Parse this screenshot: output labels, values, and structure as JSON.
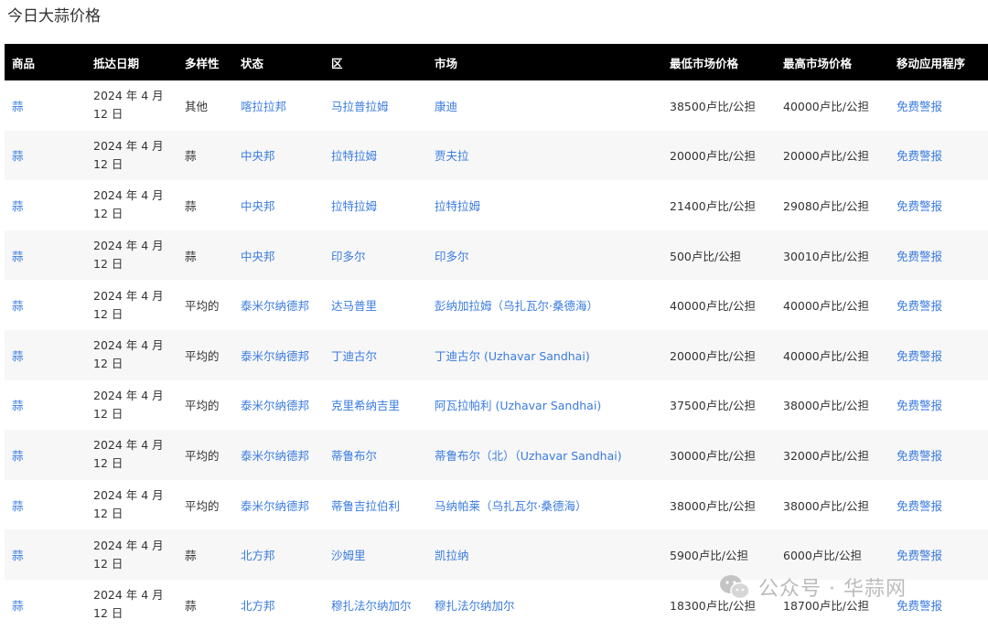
{
  "page": {
    "title": "今日大蒜价格"
  },
  "table": {
    "headers": [
      "商品",
      "抵达日期",
      "多样性",
      "状态",
      "区",
      "市场",
      "最低市场价格",
      "最高市场价格",
      "移动应用程序"
    ],
    "rows": [
      {
        "commodity": "蒜",
        "date": "2024 年 4 月 12 日",
        "variety": "其他",
        "state": "喀拉拉邦",
        "district": "马拉普拉姆",
        "market": "康迪",
        "min": "38500卢比/公担",
        "max": "40000卢比/公担",
        "app": "免费警报"
      },
      {
        "commodity": "蒜",
        "date": "2024 年 4 月 12 日",
        "variety": "蒜",
        "state": "中央邦",
        "district": "拉特拉姆",
        "market": "贾夫拉",
        "min": "20000卢比/公担",
        "max": "20000卢比/公担",
        "app": "免费警报"
      },
      {
        "commodity": "蒜",
        "date": "2024 年 4 月 12 日",
        "variety": "蒜",
        "state": "中央邦",
        "district": "拉特拉姆",
        "market": "拉特拉姆",
        "min": "21400卢比/公担",
        "max": "29080卢比/公担",
        "app": "免费警报"
      },
      {
        "commodity": "蒜",
        "date": "2024 年 4 月 12 日",
        "variety": "蒜",
        "state": "中央邦",
        "district": "印多尔",
        "market": "印多尔",
        "min": "500卢比/公担",
        "max": "30010卢比/公担",
        "app": "免费警报"
      },
      {
        "commodity": "蒜",
        "date": "2024 年 4 月 12 日",
        "variety": "平均的",
        "state": "泰米尔纳德邦",
        "district": "达马普里",
        "market": "彭纳加拉姆（乌扎瓦尔·桑德海）",
        "min": "40000卢比/公担",
        "max": "40000卢比/公担",
        "app": "免费警报"
      },
      {
        "commodity": "蒜",
        "date": "2024 年 4 月 12 日",
        "variety": "平均的",
        "state": "泰米尔纳德邦",
        "district": "丁迪古尔",
        "market": "丁迪古尔 (Uzhavar Sandhai)",
        "min": "20000卢比/公担",
        "max": "40000卢比/公担",
        "app": "免费警报"
      },
      {
        "commodity": "蒜",
        "date": "2024 年 4 月 12 日",
        "variety": "平均的",
        "state": "泰米尔纳德邦",
        "district": "克里希纳吉里",
        "market": "阿瓦拉帕利 (Uzhavar Sandhai)",
        "min": "37500卢比/公担",
        "max": "38000卢比/公担",
        "app": "免费警报"
      },
      {
        "commodity": "蒜",
        "date": "2024 年 4 月 12 日",
        "variety": "平均的",
        "state": "泰米尔纳德邦",
        "district": "蒂鲁布尔",
        "market": "蒂鲁布尔（北）（Uzhavar Sandhai)",
        "min": "30000卢比/公担",
        "max": "32000卢比/公担",
        "app": "免费警报"
      },
      {
        "commodity": "蒜",
        "date": "2024 年 4 月 12 日",
        "variety": "平均的",
        "state": "泰米尔纳德邦",
        "district": "蒂鲁吉拉伯利",
        "market": "马纳帕莱（乌扎瓦尔·桑德海）",
        "min": "38000卢比/公担",
        "max": "38000卢比/公担",
        "app": "免费警报"
      },
      {
        "commodity": "蒜",
        "date": "2024 年 4 月 12 日",
        "variety": "蒜",
        "state": "北方邦",
        "district": "沙姆里",
        "market": "凯拉纳",
        "min": "5900卢比/公担",
        "max": "6000卢比/公担",
        "app": "免费警报"
      },
      {
        "commodity": "蒜",
        "date": "2024 年 4 月 12 日",
        "variety": "蒜",
        "state": "北方邦",
        "district": "穆扎法尔纳加尔",
        "market": "穆扎法尔纳加尔",
        "min": "18300卢比/公担",
        "max": "18700卢比/公担",
        "app": "免费警报"
      }
    ]
  },
  "watermark": {
    "text": "公众号 · 华蒜网",
    "icon": "wechat-icon"
  }
}
